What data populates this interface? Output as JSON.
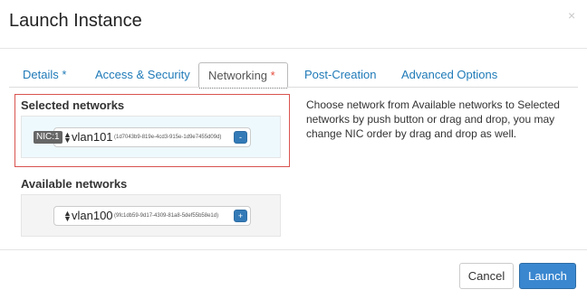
{
  "modal": {
    "title": "Launch Instance",
    "close": "×"
  },
  "tabs": [
    {
      "label": "Details",
      "required": "*"
    },
    {
      "label": "Access & Security",
      "required": ""
    },
    {
      "label": "Networking",
      "required": "*"
    },
    {
      "label": "Post-Creation",
      "required": ""
    },
    {
      "label": "Advanced Options",
      "required": ""
    }
  ],
  "active_tab": "Networking",
  "selected": {
    "label": "Selected networks",
    "items": [
      {
        "nic": "NIC:1",
        "name": "vlan101",
        "id": "(1d7043b9-819e-4cd3-915e-1d9e7455d09d)",
        "button": "-"
      }
    ]
  },
  "available": {
    "label": "Available networks",
    "items": [
      {
        "name": "vlan100",
        "id": "(9fc1db59-9d17-4309-81a8-5def55b58e1d)",
        "button": "+"
      }
    ]
  },
  "help_text": "Choose network from Available networks to Selected networks by push button or drag and drop, you may change NIC order by drag and drop as well.",
  "footer": {
    "cancel": "Cancel",
    "launch": "Launch"
  },
  "colors": {
    "accent": "#3a87d0",
    "link": "#1f7ab8",
    "highlight_border": "#d9534f",
    "selected_bg": "#eef9fe"
  },
  "icons": {
    "sort": "sort-updown-icon",
    "close": "close-icon"
  }
}
